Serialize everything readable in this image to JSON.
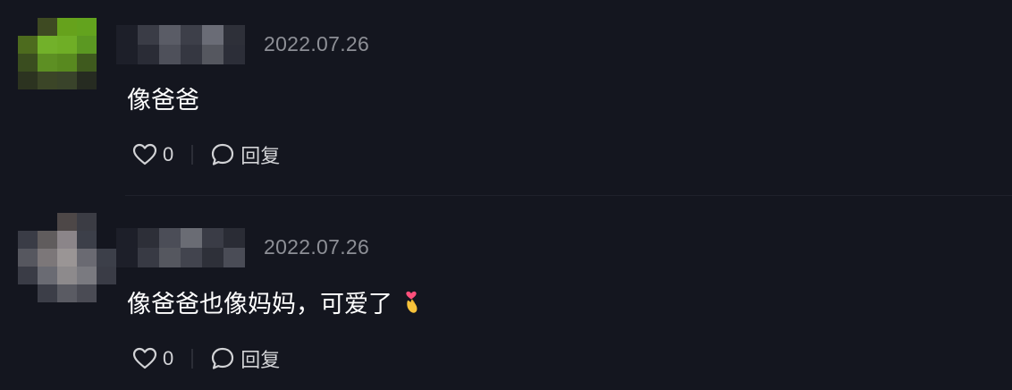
{
  "comments": [
    {
      "date": "2022.07.26",
      "text": "像爸爸",
      "likes": "0",
      "reply_label": "回复",
      "avatar_colors": [
        "#14161f",
        "#3e4a22",
        "#66a21c",
        "#63a31e",
        "#14161f",
        "#4d6b1e",
        "#72b12a",
        "#6fae26",
        "#5b9822",
        "#14161f",
        "#3a4d1f",
        "#5d8f23",
        "#58891f",
        "#3f5a1e",
        "#14161f",
        "#2c3320",
        "#3b4527",
        "#39432a",
        "#262b21",
        "#14161f",
        "#14161f",
        "#14161f",
        "#14161f",
        "#14161f",
        "#14161f"
      ]
    },
    {
      "date": "2022.07.26",
      "text": "像爸爸也像妈妈，可爱了",
      "likes": "0",
      "reply_label": "回复",
      "avatar_colors": [
        "#14161f",
        "#14161f",
        "#4d4747",
        "#3b3c44",
        "#14161f",
        "#3a3c46",
        "#605c5d",
        "#8b8589",
        "#3c3f49",
        "#14161f",
        "#56575f",
        "#7c7779",
        "#9a9595",
        "#6a6a72",
        "#3c3f49",
        "#3a3c46",
        "#6a6b73",
        "#8d8a8c",
        "#7a7a80",
        "#3a3c46",
        "#14161f",
        "#3c3e48",
        "#5a5b63",
        "#4a4b54",
        "#14161f"
      ]
    }
  ],
  "username_colors": [
    [
      "#1d1f29",
      "#3a3c46",
      "#5a5c66",
      "#3d3f49",
      "#6a6c76",
      "#2e3039",
      "#1d1f29",
      "#2a2c36",
      "#4e505a",
      "#353741",
      "#55575f",
      "#2c2e38"
    ],
    [
      "#1d1f29",
      "#2d2f38",
      "#4b4d57",
      "#6a6c74",
      "#3a3c46",
      "#2a2c35",
      "#1d1f29",
      "#383a44",
      "#55575f",
      "#42444e",
      "#2e3039",
      "#4a4c56"
    ]
  ]
}
